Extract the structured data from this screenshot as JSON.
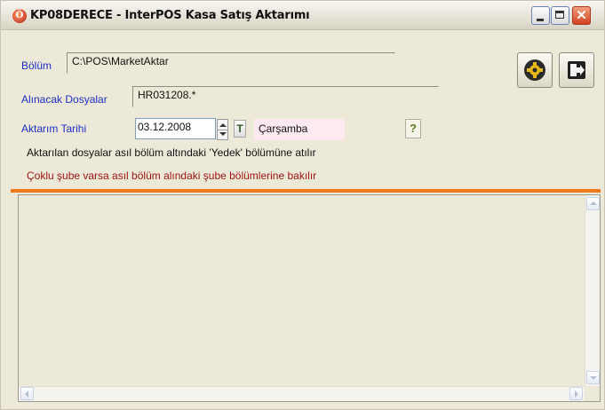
{
  "window": {
    "title": "KP08DERECE - InterPOS Kasa Satış Aktarımı",
    "icon_letter": "Ö"
  },
  "form": {
    "bolum_label": "Bölüm",
    "bolum_value": "C:\\POS\\MarketAktar",
    "dosyalar_label": "Alınacak Dosyalar",
    "dosyalar_value": "HR031208.*",
    "tarih_label": "Aktarım Tarihi",
    "tarih_value": "03.12.2008",
    "today_button_label": "T",
    "day_name": "Çarşamba",
    "help_button_label": "?"
  },
  "messages": {
    "info_black": "Aktarılan dosyalar asıl bölüm altındaki 'Yedek' bölümüne atılır",
    "info_red": "Çoklu şube varsa asıl bölüm alındaki şube bölümlerine bakılır"
  },
  "icons": {
    "run": "gear-run-icon",
    "exit": "exit-door-icon"
  },
  "colors": {
    "label_blue": "#1c2fc4",
    "warning_red": "#a11414",
    "separator_orange": "#f07a1c",
    "day_pink": "#fde9ee"
  }
}
